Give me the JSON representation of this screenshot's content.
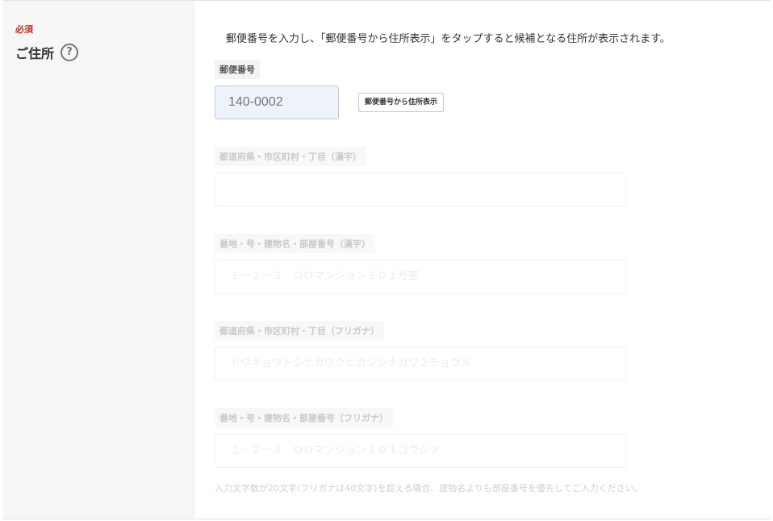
{
  "address_section": {
    "required_badge": "必須",
    "label": "ご住所",
    "help_icon": "question-circle-icon"
  },
  "instruction": "郵便番号を入力し、「郵便番号から住所表示」をタップすると候補となる住所が表示されます。",
  "postal": {
    "label": "郵便番号",
    "placeholder": "140-0002",
    "lookup_button": "郵便番号から住所表示"
  },
  "fields": [
    {
      "label": "都道府県・市区町村・丁目（漢字）",
      "placeholder": ""
    },
    {
      "label": "番地・号・建物名・部屋番号（漢字）",
      "placeholder": "１－２－３　ＯＯマンション１０１号室"
    },
    {
      "label": "都道府県・市区町村・丁目（フリガナ）",
      "placeholder": "トウキョウトシナガワクヒガシシナガワ２チョウメ"
    },
    {
      "label": "番地・号・建物名・部屋番号（フリガナ）",
      "placeholder": "１－２－３　ＯＯマンション１０１ゴウシツ"
    }
  ],
  "note": "入力文字数が20文字(フリガナは40文字)を超える場合、建物名よりも部屋番号を優先してご入力ください。",
  "colors": {
    "required": "#c0302a",
    "label_column_bg": "#f6f6f6",
    "postal_input_bg": "#eef2fb"
  }
}
